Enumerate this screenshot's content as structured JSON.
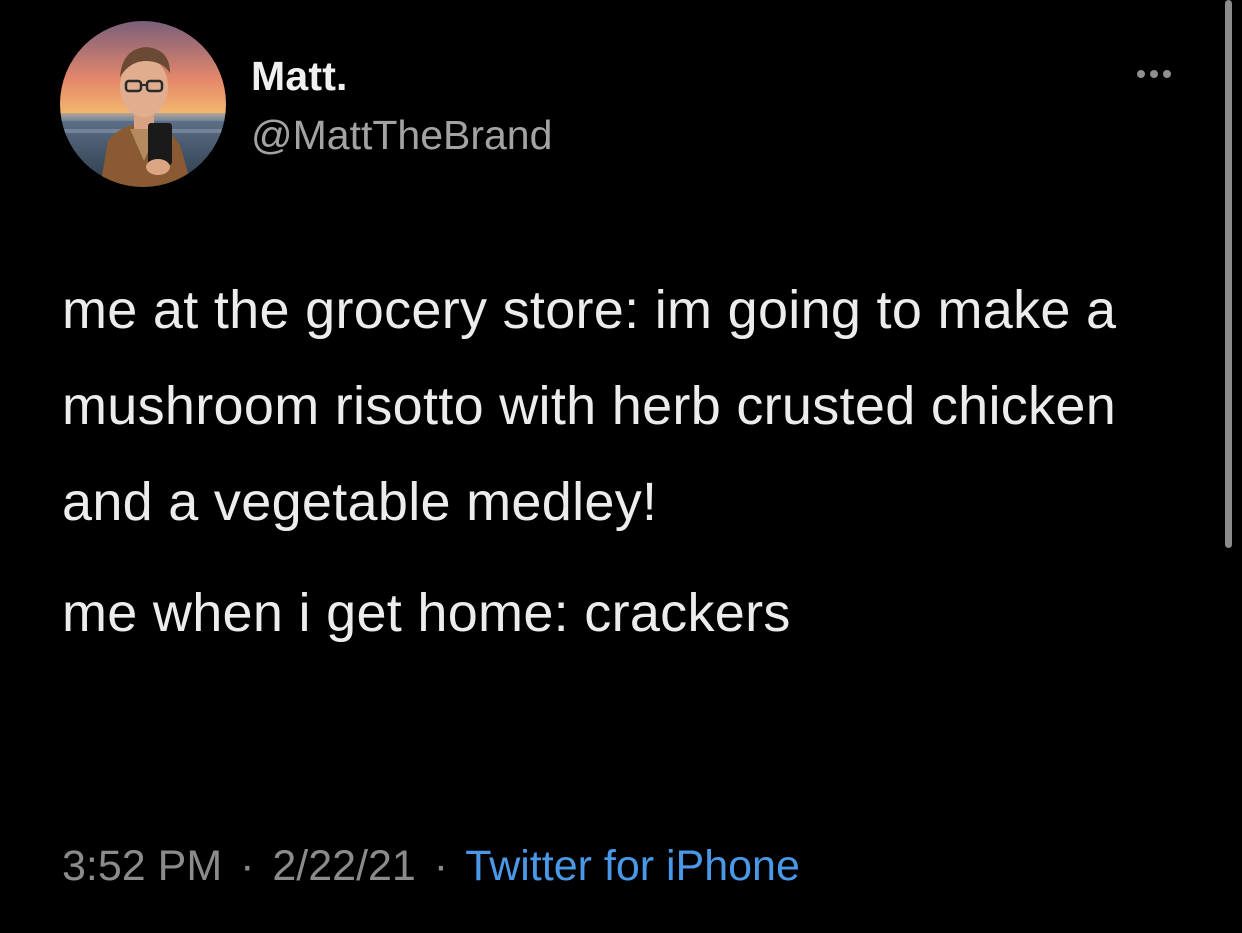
{
  "author": {
    "display_name": "Matt.",
    "handle": "@MattTheBrand",
    "avatar_icon": "profile-photo"
  },
  "tweet": {
    "paragraph_1": "me at the grocery store: im going to make a mushroom risotto with herb crusted chicken and a vegetable medley!",
    "paragraph_2": "me when i get home: crackers"
  },
  "meta": {
    "time": "3:52 PM",
    "date": "2/22/21",
    "separator": "·",
    "source": "Twitter for iPhone"
  },
  "icons": {
    "more": "more-horizontal-icon"
  },
  "colors": {
    "background": "#000000",
    "text": "#ececec",
    "secondary_text": "#8b8b8b",
    "link": "#4a99e9"
  }
}
